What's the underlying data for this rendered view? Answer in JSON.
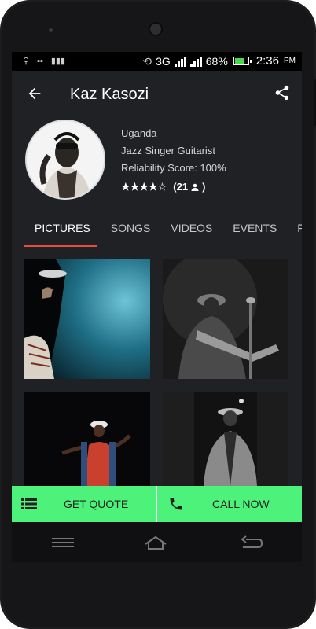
{
  "status_bar": {
    "network": "3G",
    "battery_percent": "68%",
    "battery_level": 0.68,
    "time": "2:36",
    "ampm": "PM",
    "icons": [
      "usb-icon",
      "bbm-icon",
      "barcode-icon",
      "rotate-icon",
      "signal-icon",
      "battery-icon"
    ]
  },
  "app_bar": {
    "title": "Kaz Kasozi",
    "back_icon": "arrow-back-icon",
    "share_icon": "share-icon"
  },
  "profile": {
    "country": "Uganda",
    "profession": "Jazz Singer Guitarist",
    "reliability": "Reliability Score: 100%",
    "rating_stars": 4,
    "rating_max": 5,
    "review_count": "(21",
    "review_close": ")"
  },
  "tabs": [
    {
      "label": "PICTURES",
      "active": true
    },
    {
      "label": "SONGS",
      "active": false
    },
    {
      "label": "VIDEOS",
      "active": false
    },
    {
      "label": "EVENTS",
      "active": false
    },
    {
      "label": "F",
      "active": false
    }
  ],
  "actions": {
    "quote_label": "GET QUOTE",
    "call_label": "CALL NOW"
  },
  "colors": {
    "accent": "#e74c3c",
    "action_bar": "#4cf27a",
    "screen_bg": "#1f2125"
  }
}
